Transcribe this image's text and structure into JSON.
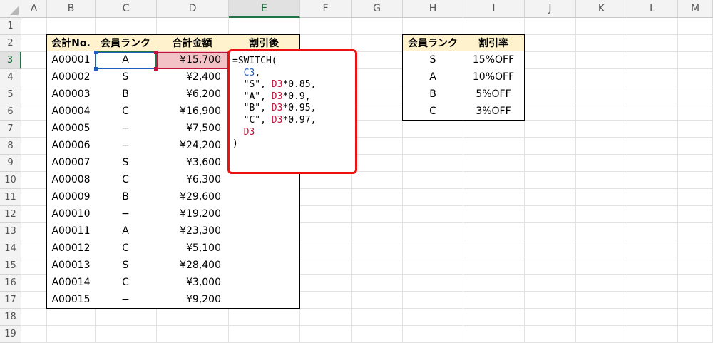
{
  "columns": [
    "A",
    "B",
    "C",
    "D",
    "E",
    "F",
    "G",
    "H",
    "I",
    "J",
    "K",
    "L",
    "M"
  ],
  "rows": [
    "1",
    "2",
    "3",
    "4",
    "5",
    "6",
    "7",
    "8",
    "9",
    "10",
    "11",
    "12",
    "13",
    "14",
    "15",
    "16",
    "17",
    "18",
    "19"
  ],
  "main_table": {
    "headers": [
      "会計No.",
      "会員ランク",
      "合計金額",
      "割引後"
    ],
    "rows": [
      {
        "no": "A00001",
        "rank": "A",
        "amount": "¥15,700"
      },
      {
        "no": "A00002",
        "rank": "S",
        "amount": "¥2,400"
      },
      {
        "no": "A00003",
        "rank": "B",
        "amount": "¥6,200"
      },
      {
        "no": "A00004",
        "rank": "C",
        "amount": "¥16,900"
      },
      {
        "no": "A00005",
        "rank": "−",
        "amount": "¥7,500"
      },
      {
        "no": "A00006",
        "rank": "−",
        "amount": "¥24,200"
      },
      {
        "no": "A00007",
        "rank": "S",
        "amount": "¥3,600"
      },
      {
        "no": "A00008",
        "rank": "C",
        "amount": "¥6,300"
      },
      {
        "no": "A00009",
        "rank": "B",
        "amount": "¥29,600"
      },
      {
        "no": "A00010",
        "rank": "−",
        "amount": "¥19,200"
      },
      {
        "no": "A00011",
        "rank": "A",
        "amount": "¥23,300"
      },
      {
        "no": "A00012",
        "rank": "C",
        "amount": "¥5,100"
      },
      {
        "no": "A00013",
        "rank": "S",
        "amount": "¥28,400"
      },
      {
        "no": "A00014",
        "rank": "C",
        "amount": "¥3,000"
      },
      {
        "no": "A00015",
        "rank": "−",
        "amount": "¥9,200"
      }
    ]
  },
  "discount_table": {
    "headers": [
      "会員ランク",
      "割引率"
    ],
    "rows": [
      {
        "rank": "S",
        "rate": "15%OFF"
      },
      {
        "rank": "A",
        "rate": "10%OFF"
      },
      {
        "rank": "B",
        "rate": "5%OFF"
      },
      {
        "rank": "C",
        "rate": "3%OFF"
      }
    ]
  },
  "formula": {
    "l1": "=SWITCH(",
    "l2a": "  ",
    "l2ref": "C3",
    "l2b": ",",
    "l3a": "  \"S\", ",
    "l3ref": "D3",
    "l3b": "*0.85,",
    "l4a": "  \"A\", ",
    "l4ref": "D3",
    "l4b": "*0.9,",
    "l5a": "  \"B\", ",
    "l5ref": "D3",
    "l5b": "*0.95,",
    "l6a": "  \"C\", ",
    "l6ref": "D3",
    "l6b": "*0.97,",
    "l7a": "  ",
    "l7ref": "D3",
    "l8": ")"
  },
  "colors": {
    "header_fill": "#fff2cc",
    "highlight_fill": "#f3c2c6",
    "formula_border": "#ee1111",
    "ref_blue": "#1f5fc0",
    "ref_red": "#c0143c",
    "selection_green": "#217346"
  },
  "selected_column": "E",
  "selected_row": "3"
}
